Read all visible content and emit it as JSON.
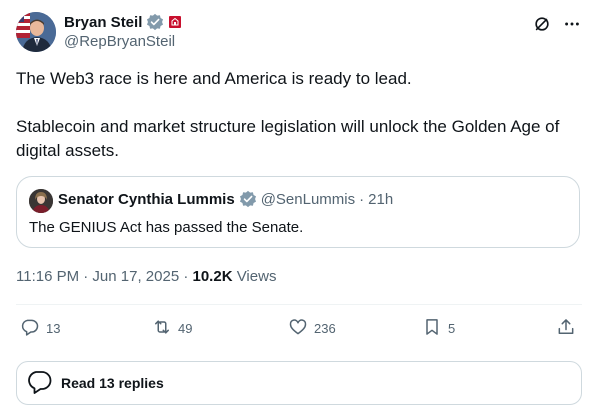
{
  "author": {
    "name": "Bryan Steil",
    "handle": "@RepBryanSteil",
    "verified_color": "#829aab",
    "affiliation_color": "#c8102e"
  },
  "tweet": {
    "line1": "The Web3 race is here and America is ready to lead.",
    "line2": "Stablecoin and market structure legislation will unlock the Golden Age of digital assets."
  },
  "quote": {
    "name": "Senator Cynthia Lummis",
    "handle": "@SenLummis",
    "separator": "·",
    "time": "21h",
    "text": "The GENIUS Act has passed the Senate."
  },
  "meta": {
    "timestamp": "11:16 PM · Jun 17, 2025 ·",
    "views_count": "10.2K",
    "views_label": "Views"
  },
  "actions": {
    "replies": "13",
    "reposts": "49",
    "likes": "236",
    "bookmarks": "5"
  },
  "read_replies": "Read 13 replies",
  "icons": [
    "grok-icon",
    "more-icon",
    "reply-icon",
    "repost-icon",
    "like-icon",
    "bookmark-icon",
    "share-icon",
    "replies-bubble-icon"
  ]
}
